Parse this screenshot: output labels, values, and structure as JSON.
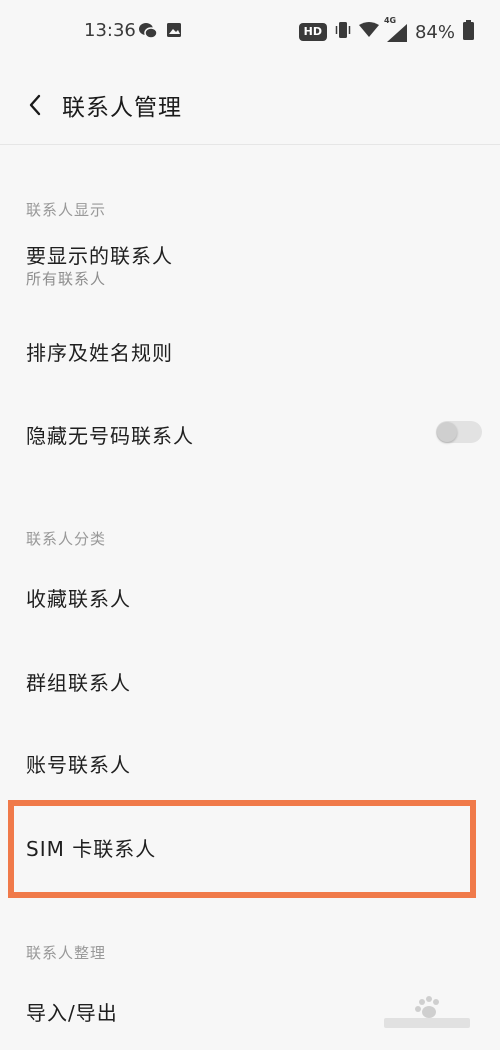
{
  "status_bar": {
    "time": "13:36",
    "left_icons": [
      "wechat-icon",
      "image-icon"
    ],
    "hd_badge": "HD",
    "network_label": "4G",
    "battery_percent": "84%"
  },
  "header": {
    "title": "联系人管理"
  },
  "sections": {
    "display": {
      "header": "联系人显示",
      "items": {
        "contacts_to_display": {
          "title": "要显示的联系人",
          "subtitle": "所有联系人"
        },
        "sort_and_name": {
          "title": "排序及姓名规则"
        },
        "hide_no_number": {
          "title": "隐藏无号码联系人",
          "toggle_on": false
        }
      }
    },
    "category": {
      "header": "联系人分类",
      "items": {
        "favorites": {
          "title": "收藏联系人"
        },
        "groups": {
          "title": "群组联系人"
        },
        "accounts": {
          "title": "账号联系人"
        },
        "sim": {
          "title": "SIM 卡联系人"
        }
      }
    },
    "organize": {
      "header": "联系人整理",
      "items": {
        "import_export": {
          "title": "导入/导出"
        }
      }
    }
  },
  "colors": {
    "background": "#f7f7f7",
    "highlight": "#f07a4a",
    "section_header": "#999999",
    "toggle_off": "#e2e2e2"
  }
}
